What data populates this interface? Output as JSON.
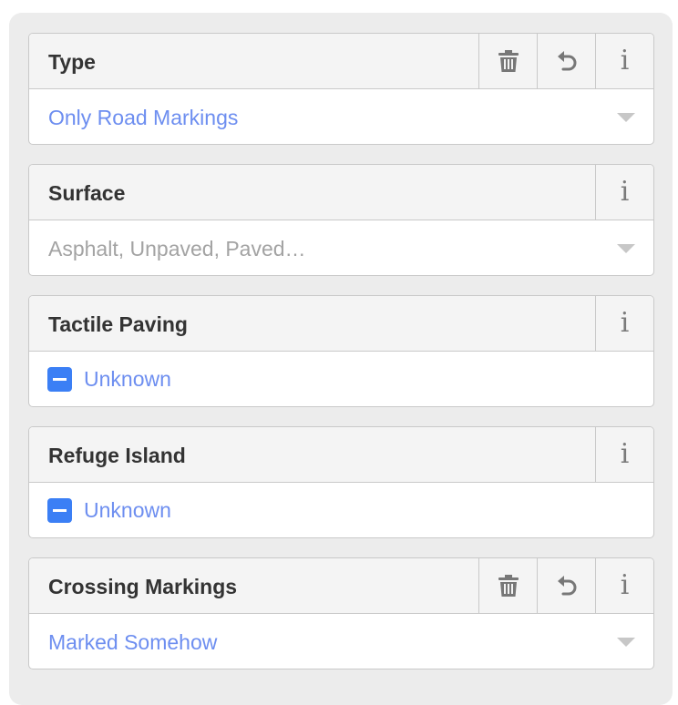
{
  "fields": [
    {
      "label": "Type",
      "kind": "combo",
      "value": "Only Road Markings",
      "buttons": [
        "trash-icon",
        "undo-icon",
        "info-icon"
      ]
    },
    {
      "label": "Surface",
      "kind": "combo",
      "value": "",
      "placeholder": "Asphalt, Unpaved, Paved…",
      "buttons": [
        "info-icon"
      ]
    },
    {
      "label": "Tactile Paving",
      "kind": "check",
      "value": "Unknown",
      "buttons": [
        "info-icon"
      ]
    },
    {
      "label": "Refuge Island",
      "kind": "check",
      "value": "Unknown",
      "buttons": [
        "info-icon"
      ]
    },
    {
      "label": "Crossing Markings",
      "kind": "combo",
      "value": "Marked Somehow",
      "buttons": [
        "trash-icon",
        "undo-icon",
        "info-icon"
      ]
    }
  ],
  "info_glyph": "i",
  "colors": {
    "value_text": "#6d8ef0",
    "placeholder_text": "#a3a3a3",
    "checkbox_fill": "#3b7ff5",
    "panel_bg": "#ececec"
  }
}
